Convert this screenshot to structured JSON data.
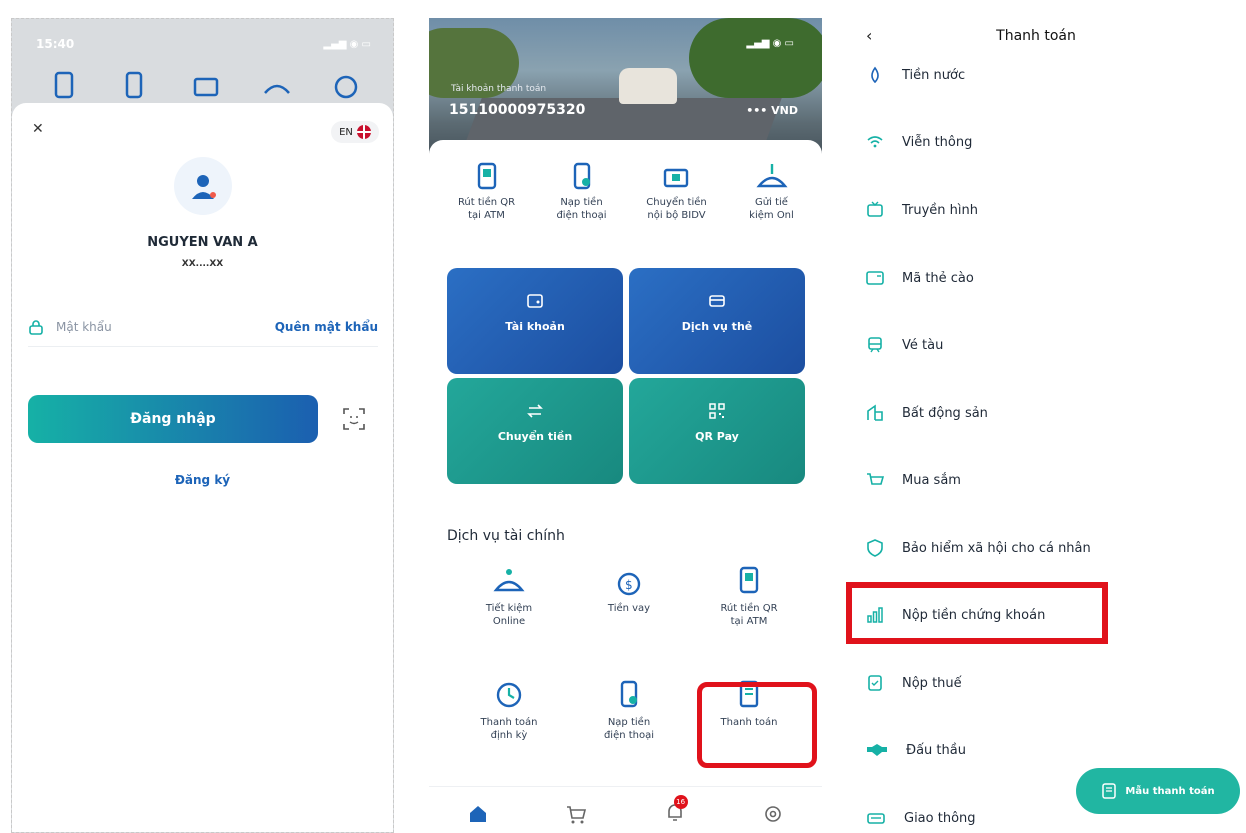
{
  "colors": {
    "accent_blue": "#1d64b8",
    "teal": "#21b6a2",
    "highlight_red": "#e0121b"
  },
  "login": {
    "time": "15:40",
    "lang": "EN",
    "user_name": "NGUYEN VAN A",
    "user_id": "XX....XX",
    "password_placeholder": "Mật khẩu",
    "forgot_password": "Quên mật khẩu",
    "login_button": "Đăng nhập",
    "register": "Đăng ký"
  },
  "home": {
    "account_label": "Tài khoản thanh toán",
    "account_number": "15110000975320",
    "balance": "••• VND",
    "quick_actions": [
      {
        "label": "Rút tiền QR\ntại ATM",
        "icon": "atm-qr-icon"
      },
      {
        "label": "Nạp tiền\nđiện thoại",
        "icon": "phone-topup-icon"
      },
      {
        "label": "Chuyển tiền\nnội bộ BIDV",
        "icon": "transfer-internal-icon"
      },
      {
        "label": "Gửi tiế\nkiệm Onl",
        "icon": "savings-icon"
      }
    ],
    "tiles": [
      {
        "label": "Tài khoản",
        "icon": "wallet-icon"
      },
      {
        "label": "Dịch vụ thẻ",
        "icon": "card-icon"
      },
      {
        "label": "Chuyển tiền",
        "icon": "transfer-icon"
      },
      {
        "label": "QR Pay",
        "icon": "qr-icon"
      }
    ],
    "section_title": "Dịch vụ tài chính",
    "financial_services": [
      {
        "label": "Tiết kiệm\nOnline",
        "icon": "savings-icon"
      },
      {
        "label": "Tiền vay",
        "icon": "money-bag-icon"
      },
      {
        "label": "Rút tiền QR\ntại ATM",
        "icon": "atm-qr-icon"
      },
      {
        "label": "Thanh toán\nđịnh kỳ",
        "icon": "recurring-payment-icon"
      },
      {
        "label": "Nạp tiền\nđiện thoại",
        "icon": "phone-topup-icon"
      },
      {
        "label": "Thanh toán",
        "icon": "bill-payment-icon"
      }
    ],
    "nav_badge": "16"
  },
  "payments": {
    "title": "Thanh toán",
    "items": [
      {
        "label": "Tiền nước",
        "icon": "water-drop-icon"
      },
      {
        "label": "Viễn thông",
        "icon": "wifi-icon"
      },
      {
        "label": "Truyền hình",
        "icon": "tv-icon"
      },
      {
        "label": "Mã thẻ cào",
        "icon": "scratch-card-icon"
      },
      {
        "label": "Vé tàu",
        "icon": "train-icon"
      },
      {
        "label": "Bất động sản",
        "icon": "building-icon"
      },
      {
        "label": "Mua sắm",
        "icon": "cart-icon"
      },
      {
        "label": "Bảo hiểm xã hội cho cá nhân",
        "icon": "shield-icon"
      },
      {
        "label": "Nộp tiền chứng khoán",
        "icon": "stock-chart-icon"
      },
      {
        "label": "Nộp thuế",
        "icon": "tax-doc-icon"
      },
      {
        "label": "Đấu thầu",
        "icon": "handshake-icon"
      },
      {
        "label": "Giao thông",
        "icon": "car-icon"
      }
    ],
    "fab_label": "Mẫu thanh toán"
  }
}
